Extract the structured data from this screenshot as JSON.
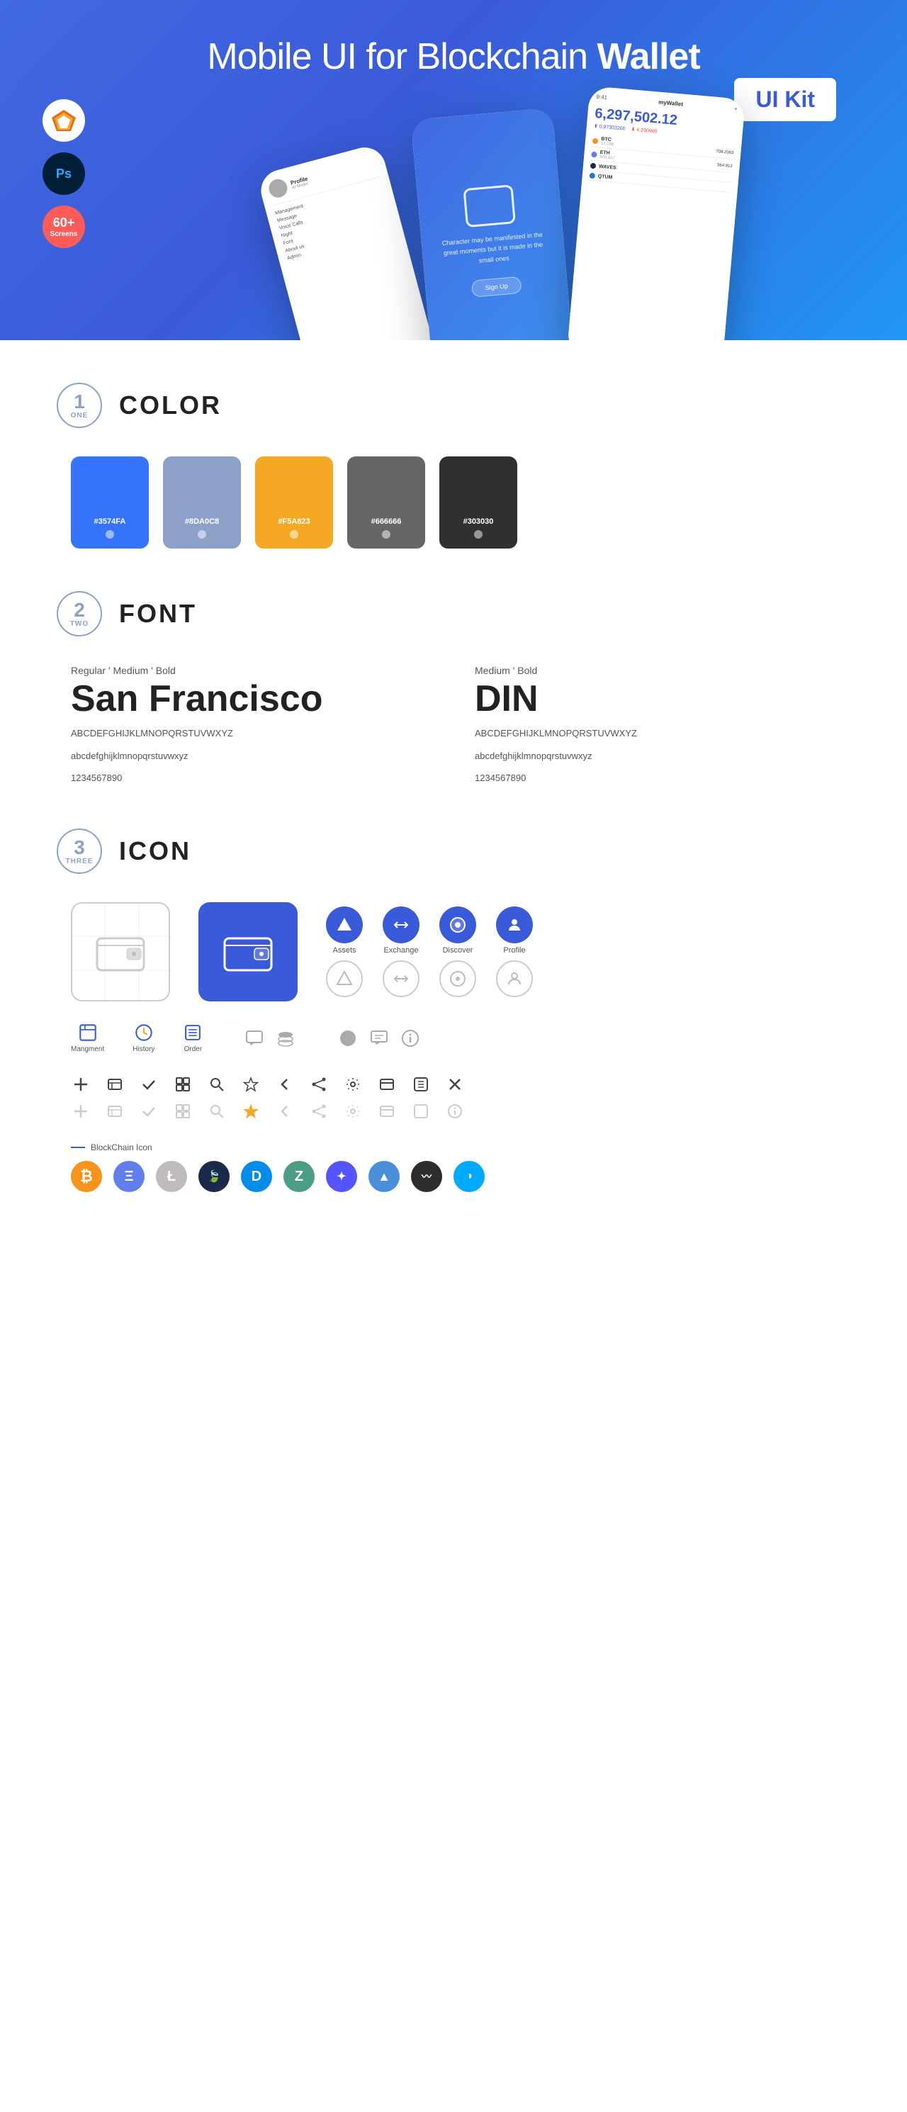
{
  "hero": {
    "title_normal": "Mobile UI for Blockchain",
    "title_bold": "Wallet",
    "badge": "UI Kit",
    "sketch_label": "Sketch",
    "ps_label": "Ps",
    "screens_count": "60+",
    "screens_label": "Screens"
  },
  "section1": {
    "number": "1",
    "word": "ONE",
    "title": "COLOR",
    "colors": [
      {
        "hex": "#3574FA",
        "label": "#3574FA"
      },
      {
        "hex": "#8DA0C8",
        "label": "#8DA0C8"
      },
      {
        "hex": "#F5A823",
        "label": "#F5A823"
      },
      {
        "hex": "#666666",
        "label": "#666666"
      },
      {
        "hex": "#303030",
        "label": "#303030"
      }
    ]
  },
  "section2": {
    "number": "2",
    "word": "TWO",
    "title": "FONT",
    "font1": {
      "style": "Regular ' Medium ' Bold",
      "name": "San Francisco",
      "uppercase": "ABCDEFGHIJKLMNOPQRSTUVWXYZ",
      "lowercase": "abcdefghijklmnopqrstuvwxyz",
      "numbers": "1234567890"
    },
    "font2": {
      "style": "Medium ' Bold",
      "name": "DIN",
      "uppercase": "ABCDEFGHIJKLMNOPQRSTUVWXYZ",
      "lowercase": "abcdefghijklmnopqrstuvwxyz",
      "numbers": "1234567890"
    }
  },
  "section3": {
    "number": "3",
    "word": "THREE",
    "title": "ICON",
    "nav_icons": [
      {
        "label": "Assets",
        "icon": "◈"
      },
      {
        "label": "Exchange",
        "icon": "⇌"
      },
      {
        "label": "Discover",
        "icon": "◉"
      },
      {
        "label": "Profile",
        "icon": "👤"
      }
    ],
    "bottom_icons": [
      {
        "label": "Mangment",
        "icon": "▭"
      },
      {
        "label": "History",
        "icon": "⏱"
      },
      {
        "label": "Order",
        "icon": "≡"
      }
    ],
    "blockchain_label": "BlockChain Icon",
    "crypto_coins": [
      {
        "color": "#F7931A",
        "symbol": "₿",
        "name": "Bitcoin"
      },
      {
        "color": "#627EEA",
        "symbol": "Ξ",
        "name": "Ethereum"
      },
      {
        "color": "#BFBBBB",
        "symbol": "Ł",
        "name": "Litecoin"
      },
      {
        "color": "#1B2A4A",
        "symbol": "🍃",
        "name": "Blackcoin"
      },
      {
        "color": "#008CE7",
        "symbol": "D",
        "name": "Dash"
      },
      {
        "color": "#4B9E85",
        "symbol": "Z",
        "name": "Zcash"
      },
      {
        "color": "#5555FF",
        "symbol": "✦",
        "name": "Dfinity"
      },
      {
        "color": "#4A90D9",
        "symbol": "▲",
        "name": "Aion"
      },
      {
        "color": "#2D2D2D",
        "symbol": "〰",
        "name": "GXChain"
      },
      {
        "color": "#00AAFF",
        "symbol": "◑",
        "name": "Stellar"
      }
    ]
  }
}
